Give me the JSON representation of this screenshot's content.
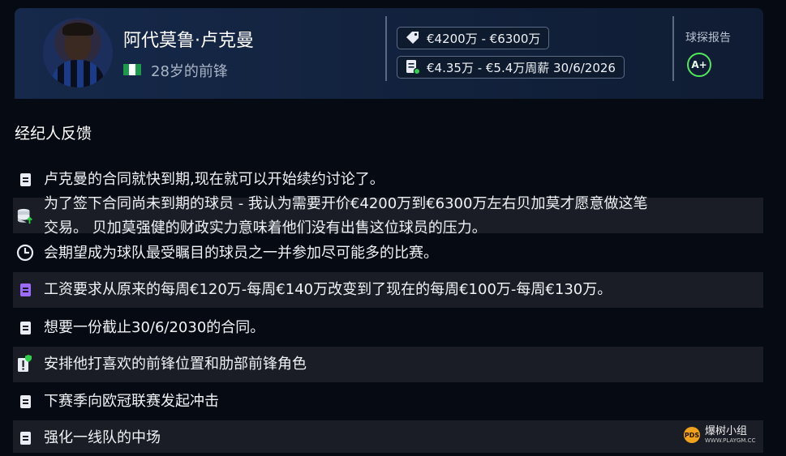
{
  "player": {
    "name": "阿代莫鲁·卢克曼",
    "subtitle": "28岁的前锋",
    "flag_colors": [
      "#1a9a4a",
      "#ffffff",
      "#1a9a4a"
    ]
  },
  "value_chip": {
    "icon": "price-tag-icon",
    "text": "€4200万 - €6300万"
  },
  "contract_chip": {
    "icon": "contract-icon",
    "text": "€4.35万 - €5.4万周薪 30/6/2026"
  },
  "scout_report": {
    "label": "球探报告",
    "grade": "A+",
    "grade_color": "#4ee85a"
  },
  "feedback": {
    "title": "经纪人反馈",
    "items": [
      {
        "icon": "document-icon",
        "text": "卢克曼的合同就快到期,现在就可以开始续约讨论了。"
      },
      {
        "icon": "coins-up-icon",
        "lines": [
          "为了签下合同尚未到期的球员 - 我认为需要开价€4200万到€6300万左右贝加莫才愿意做这笔",
          "交易。 贝加莫强健的财政实力意味着他们没有出售这位球员的压力。"
        ]
      },
      {
        "icon": "clock-icon",
        "text": "会期望成为球队最受瞩目的球员之一并参加尽可能多的比赛。"
      },
      {
        "icon": "document-purple-icon",
        "text": "工资要求从原来的每周€120万-每周€140万改变到了现在的每周€100万-每周€130万。"
      },
      {
        "icon": "document-icon",
        "text": "想要一份截止30/6/2030的合同。"
      },
      {
        "icon": "alert-shield-icon",
        "text": "安排他打喜欢的前锋位置和肋部前锋角色"
      },
      {
        "icon": "document-icon",
        "text": "下赛季向欧冠联赛发起冲击"
      },
      {
        "icon": "document-icon",
        "text": "强化一线队的中场"
      }
    ]
  },
  "watermark": {
    "brand": "爆树小组",
    "url": "WWW.PLAYGM.CC",
    "badge": "PDS"
  }
}
